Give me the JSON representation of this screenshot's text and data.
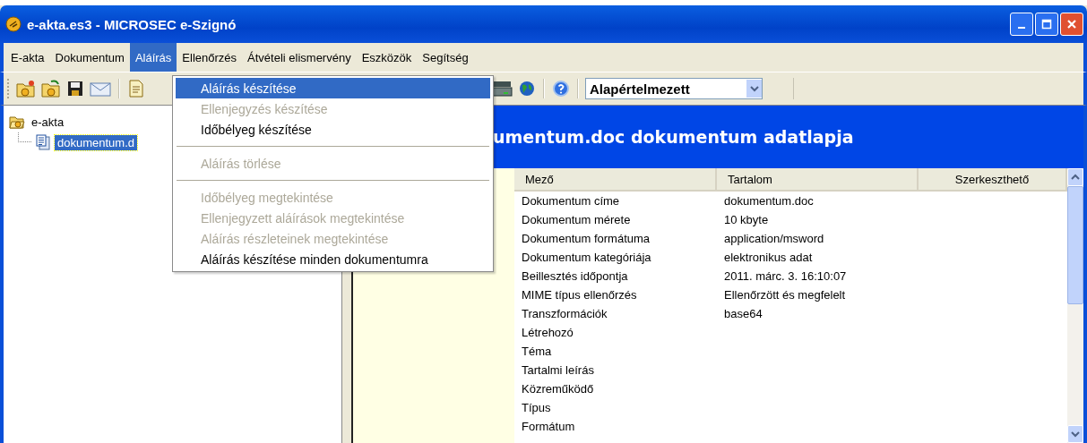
{
  "window": {
    "title": "e-akta.es3 - MICROSEC e-Szignó"
  },
  "menu_bar": [
    {
      "label": "E-akta",
      "selected": false
    },
    {
      "label": "Dokumentum",
      "selected": false
    },
    {
      "label": "Aláírás",
      "selected": true
    },
    {
      "label": "Ellenőrzés",
      "selected": false
    },
    {
      "label": "Átvételi elismervény",
      "selected": false
    },
    {
      "label": "Eszközök",
      "selected": false
    },
    {
      "label": "Segítség",
      "selected": false
    }
  ],
  "toolbar": {
    "profile": "Alapértelmezett"
  },
  "tree": [
    {
      "label": "e-akta",
      "selected": false,
      "expanded": true,
      "children": [
        {
          "label": "dokumentum.d",
          "selected": true
        }
      ]
    }
  ],
  "menu": [
    {
      "kind": "item",
      "label": "Aláírás készítése",
      "disabled": false,
      "selected": true
    },
    {
      "kind": "item",
      "label": "Ellenjegyzés készítése",
      "disabled": true,
      "selected": false
    },
    {
      "kind": "item",
      "label": "Időbélyeg készítése",
      "disabled": false,
      "selected": false
    },
    {
      "kind": "separator"
    },
    {
      "kind": "item",
      "label": "Aláírás törlése",
      "disabled": true,
      "selected": false
    },
    {
      "kind": "separator"
    },
    {
      "kind": "item",
      "label": "Időbélyeg megtekintése",
      "disabled": true,
      "selected": false
    },
    {
      "kind": "item",
      "label": "Ellenjegyzett aláírások megtekintése",
      "disabled": true,
      "selected": false
    },
    {
      "kind": "item",
      "label": "Aláírás részleteinek megtekintése",
      "disabled": true,
      "selected": false
    },
    {
      "kind": "item",
      "label": "Aláírás készítése minden dokumentumra",
      "disabled": false,
      "selected": false
    }
  ],
  "heading": "umentum.doc dokumentum adatlapja",
  "table": {
    "columns": [
      "Mező",
      "Tartalom",
      "Szerkeszthető"
    ],
    "rows": [
      [
        "Dokumentum címe",
        "dokumentum.doc"
      ],
      [
        "Dokumentum mérete",
        "10 kbyte"
      ],
      [
        "Dokumentum formátuma",
        "application/msword"
      ],
      [
        "Dokumentum kategóriája",
        "elektronikus adat"
      ],
      [
        "Beillesztés időpontja",
        "2011. márc. 3. 16:10:07"
      ],
      [
        "MIME típus ellenőrzés",
        "Ellenőrzött és megfelelt"
      ],
      [
        "Transzformációk",
        "base64"
      ],
      [
        "Létrehozó"
      ],
      [
        "Téma"
      ],
      [
        "Tartalmi leírás"
      ],
      [
        "Közreműködő"
      ],
      [
        "Típus"
      ],
      [
        "Formátum"
      ]
    ]
  }
}
